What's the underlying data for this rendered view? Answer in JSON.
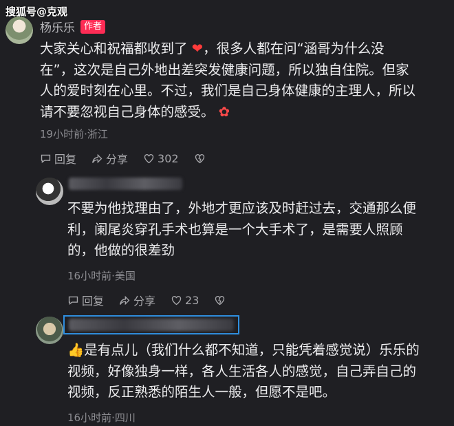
{
  "watermark": "搜狐号@克观",
  "comments": [
    {
      "name": "杨乐乐",
      "badge": "作者",
      "lines": [
        "大家关心和祝福都收到了",
        "，很多人都在问“涵哥为什么没",
        "在”，这次是自己外地出差突发健康问题，所以独自住院。但家",
        "人的爱时刻在心里。不过，我们是自己身体健康的主理人，所以",
        "请不要忽视自己身体的感受。"
      ],
      "meta": "19小时前·浙江",
      "reply_label": "回复",
      "share_label": "分享",
      "likes": "302"
    },
    {
      "lines": [
        "不要为他找理由了，外地才更应该及时赶过去，交通那么便",
        "利，阑尾炎穿孔手术也算是一个大手术了，是需要人照顾",
        "的，他做的很差劲"
      ],
      "meta": "16小时前·美国",
      "reply_label": "回复",
      "share_label": "分享",
      "likes": "23"
    },
    {
      "lines": [
        "是有点儿（我们什么都不知道，只能凭着感觉说）乐乐的",
        "视频，好像独身一样，各人生活各人的感觉，自己弄自己的",
        "视频，反正熟悉的陌生人一般，但愿不是吧。"
      ],
      "meta": "16小时前·四川"
    }
  ],
  "colors": {
    "accent_badge": "#fe2c55",
    "highlight_border": "#2f8fe0"
  }
}
